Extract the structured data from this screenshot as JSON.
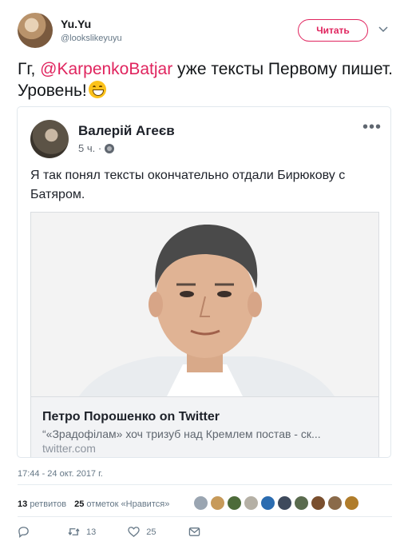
{
  "author": {
    "name": "Yu.Yu",
    "handle": "@lookslikeyuyu"
  },
  "follow_label": "Читать",
  "tweet": {
    "prefix": "Гг, ",
    "mention": "@KarpenkoBatjar",
    "text_after": " уже тексты Первому пишет. Уровень!"
  },
  "embed": {
    "author_name": "Валерій Агеєв",
    "time": "5 ч. ·",
    "text": "Я так понял тексты окончательно отдали Бирюкову с Батяром.",
    "link": {
      "title": "Петро Порошенко on Twitter",
      "description": "“«Зрадофілам» хоч тризуб над Кремлем постав - ск...",
      "domain": "twitter.com"
    }
  },
  "timestamp": "17:44 - 24 окт. 2017 г.",
  "stats": {
    "retweets_count": "13",
    "retweets_label": "ретвитов",
    "likes_count": "25",
    "likes_label": "отметок «Нравится»"
  },
  "likers_colors": [
    "#9aa5b1",
    "#c79a5a",
    "#4d6b3a",
    "#b5b0a5",
    "#2b6cb0",
    "#3e4a5c",
    "#5a6b4e",
    "#7a4f2e",
    "#8a6a4a",
    "#b07c2a"
  ],
  "actions": {
    "reply_count": "",
    "retweet_count": "13",
    "like_count": "25"
  },
  "colors": {
    "accent": "#e0245e",
    "muted": "#657786"
  }
}
